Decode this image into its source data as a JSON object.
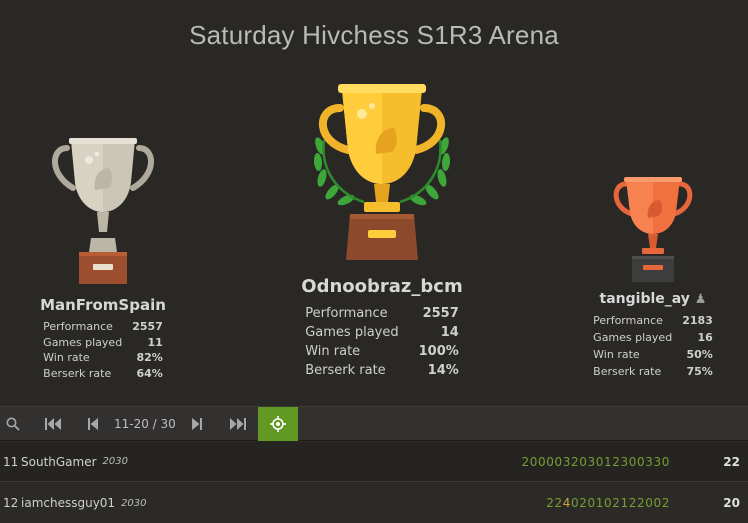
{
  "title": "Saturday Hivchess S1R3 Arena",
  "podium": {
    "first": {
      "name": "Odnoobraz_bcm",
      "stats": [
        {
          "label": "Performance",
          "value": "2557"
        },
        {
          "label": "Games played",
          "value": "14"
        },
        {
          "label": "Win rate",
          "value": "100%"
        },
        {
          "label": "Berserk rate",
          "value": "14%"
        }
      ]
    },
    "second": {
      "name": "ManFromSpain",
      "stats": [
        {
          "label": "Performance",
          "value": "2557"
        },
        {
          "label": "Games played",
          "value": "11"
        },
        {
          "label": "Win rate",
          "value": "82%"
        },
        {
          "label": "Berserk rate",
          "value": "64%"
        }
      ]
    },
    "third": {
      "name": "tangible_ay",
      "badge": "♟",
      "stats": [
        {
          "label": "Performance",
          "value": "2183"
        },
        {
          "label": "Games played",
          "value": "16"
        },
        {
          "label": "Win rate",
          "value": "50%"
        },
        {
          "label": "Berserk rate",
          "value": "75%"
        }
      ]
    }
  },
  "pager": {
    "range": "11-20 / 30",
    "icons": [
      "search-icon",
      "first-page-icon",
      "prev-page-icon",
      "next-page-icon",
      "last-page-icon",
      "locate-me-icon"
    ]
  },
  "standings": [
    {
      "rank": "11",
      "name": "SouthGamer",
      "rating": "2030",
      "sheet": [
        {
          "d": "2",
          "c": "g"
        },
        {
          "d": "0",
          "c": "g"
        },
        {
          "d": "0",
          "c": "g"
        },
        {
          "d": "0",
          "c": "g"
        },
        {
          "d": "0",
          "c": "g"
        },
        {
          "d": "3",
          "c": "g"
        },
        {
          "d": "2",
          "c": "g"
        },
        {
          "d": "0",
          "c": "g"
        },
        {
          "d": "3",
          "c": "g"
        },
        {
          "d": "0",
          "c": "g"
        },
        {
          "d": "1",
          "c": "g"
        },
        {
          "d": "2",
          "c": "g"
        },
        {
          "d": "3",
          "c": "g"
        },
        {
          "d": "0",
          "c": "g"
        },
        {
          "d": "0",
          "c": "g"
        },
        {
          "d": "3",
          "c": "g"
        },
        {
          "d": "3",
          "c": "g"
        },
        {
          "d": "0",
          "c": "g"
        }
      ],
      "score": "22"
    },
    {
      "rank": "12",
      "name": "iamchessguy01",
      "rating": "2030",
      "sheet": [
        {
          "d": "2",
          "c": "g"
        },
        {
          "d": "2",
          "c": "g"
        },
        {
          "d": "4",
          "c": "o"
        },
        {
          "d": "0",
          "c": "g"
        },
        {
          "d": "2",
          "c": "g"
        },
        {
          "d": "0",
          "c": "g"
        },
        {
          "d": "1",
          "c": "g"
        },
        {
          "d": "0",
          "c": "g"
        },
        {
          "d": "2",
          "c": "g"
        },
        {
          "d": "1",
          "c": "g"
        },
        {
          "d": "2",
          "c": "g"
        },
        {
          "d": "2",
          "c": "g"
        },
        {
          "d": "0",
          "c": "g"
        },
        {
          "d": "0",
          "c": "g"
        },
        {
          "d": "2",
          "c": "g"
        }
      ],
      "score": "20"
    }
  ]
}
